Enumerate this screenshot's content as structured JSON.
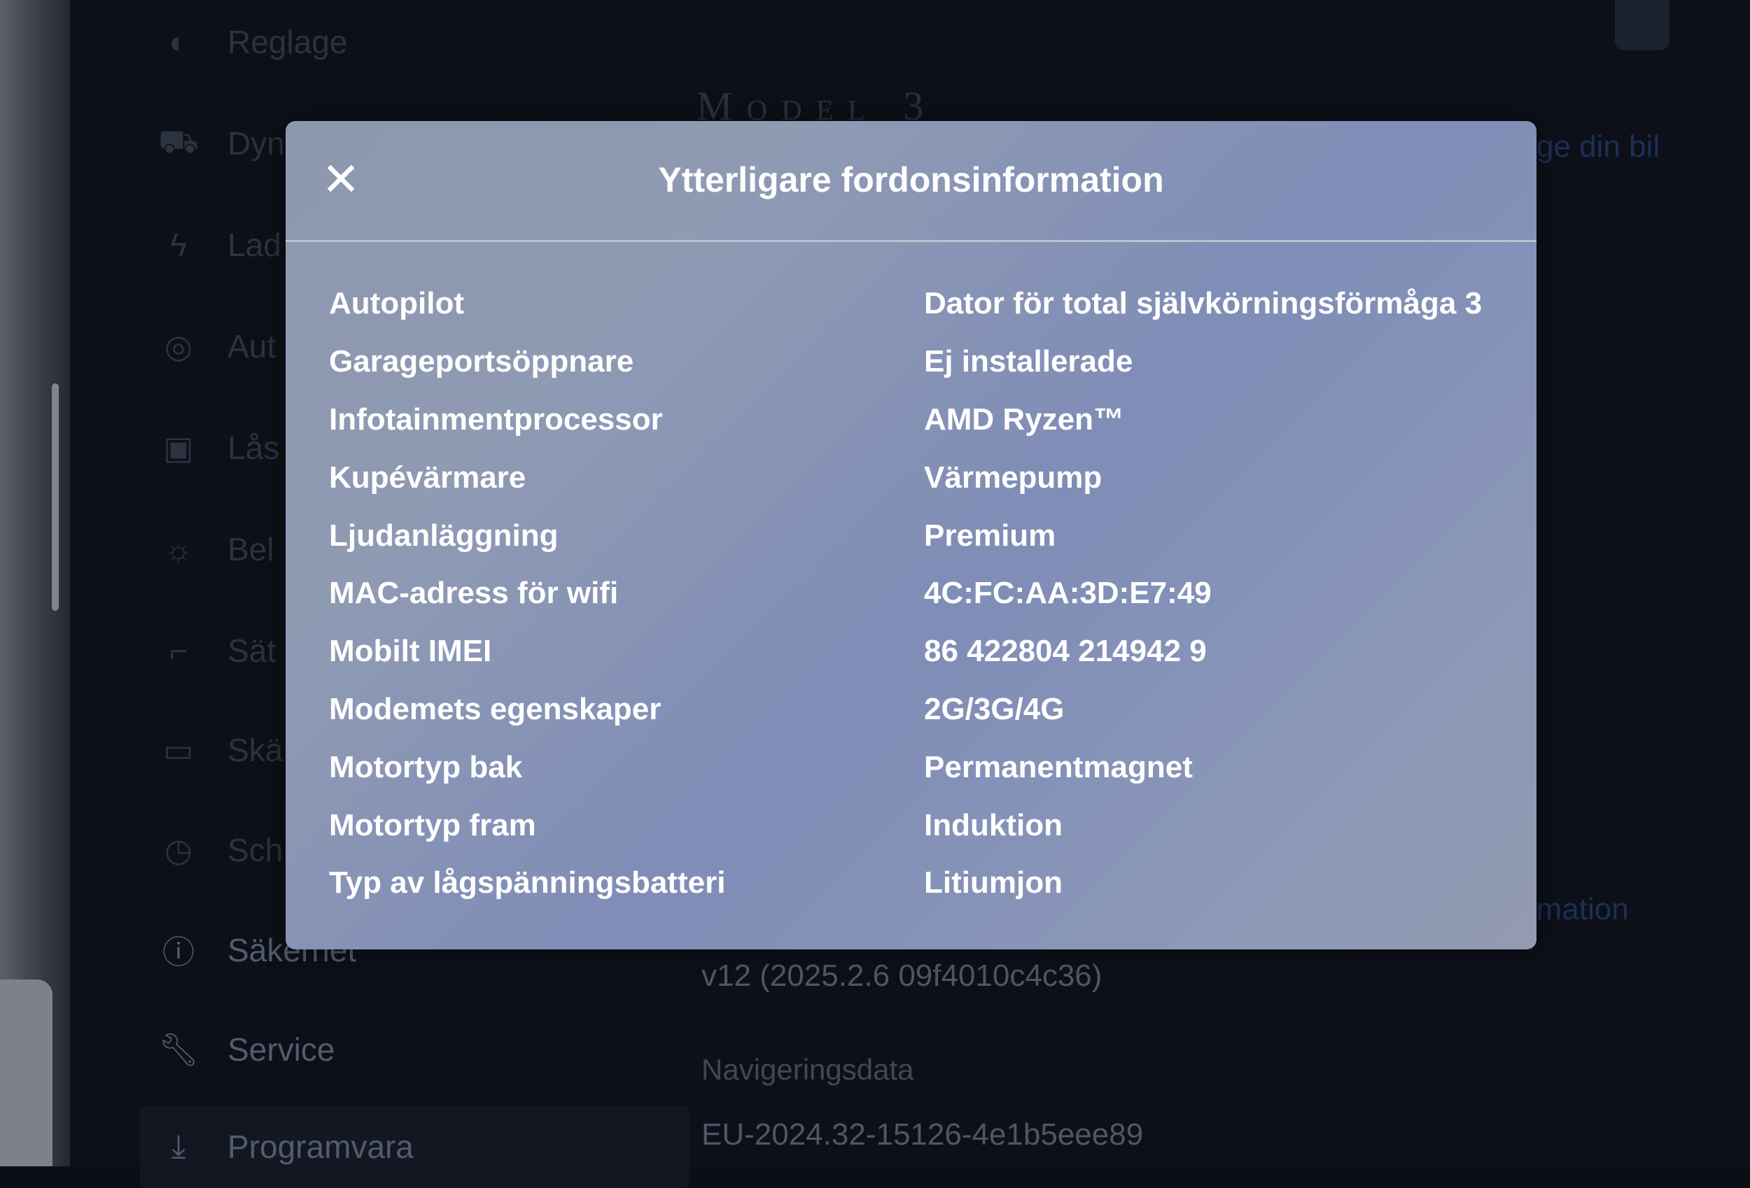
{
  "menu": {
    "items": [
      {
        "label": "Reglage",
        "icon": "toggle-icon"
      },
      {
        "label": "Dyn",
        "icon": "car-icon"
      },
      {
        "label": "Lad",
        "icon": "bolt-icon"
      },
      {
        "label": "Aut",
        "icon": "steering-wheel-icon"
      },
      {
        "label": "Lås",
        "icon": "lock-icon"
      },
      {
        "label": "Bel",
        "icon": "sun-icon"
      },
      {
        "label": "Sät",
        "icon": "seat-icon"
      },
      {
        "label": "Skä",
        "icon": "display-icon"
      },
      {
        "label": "Sch",
        "icon": "clock-icon"
      },
      {
        "label": "Säkerhet",
        "icon": "info-icon"
      },
      {
        "label": "Service",
        "icon": "wrench-icon"
      },
      {
        "label": "Programvara",
        "icon": "download-icon"
      }
    ]
  },
  "background": {
    "brand": "Model 3",
    "link_top": "ge din bil",
    "link_mid": "rmation",
    "version": "v12 (2025.2.6 09f4010c4c36)",
    "nav_label": "Navigeringsdata",
    "nav_value": "EU-2024.32-15126-4e1b5eee89"
  },
  "modal": {
    "title": "Ytterligare fordonsinformation",
    "close_icon": "close-icon",
    "rows": [
      {
        "label": "Autopilot",
        "value": "Dator för total självkörningsförmåga 3"
      },
      {
        "label": "Garageportsöppnare",
        "value": "Ej installerade"
      },
      {
        "label": "Infotainmentprocessor",
        "value": "AMD Ryzen™"
      },
      {
        "label": "Kupévärmare",
        "value": "Värmepump"
      },
      {
        "label": "Ljudanläggning",
        "value": "Premium"
      },
      {
        "label": "MAC-adress för wifi",
        "value": "4C:FC:AA:3D:E7:49"
      },
      {
        "label": "Mobilt IMEI",
        "value": "86 422804 214942 9"
      },
      {
        "label": "Modemets egenskaper",
        "value": "2G/3G/4G"
      },
      {
        "label": "Motortyp bak",
        "value": "Permanentmagnet"
      },
      {
        "label": "Motortyp fram",
        "value": "Induktion"
      },
      {
        "label": "Typ av lågspänningsbatteri",
        "value": "Litiumjon"
      }
    ]
  }
}
